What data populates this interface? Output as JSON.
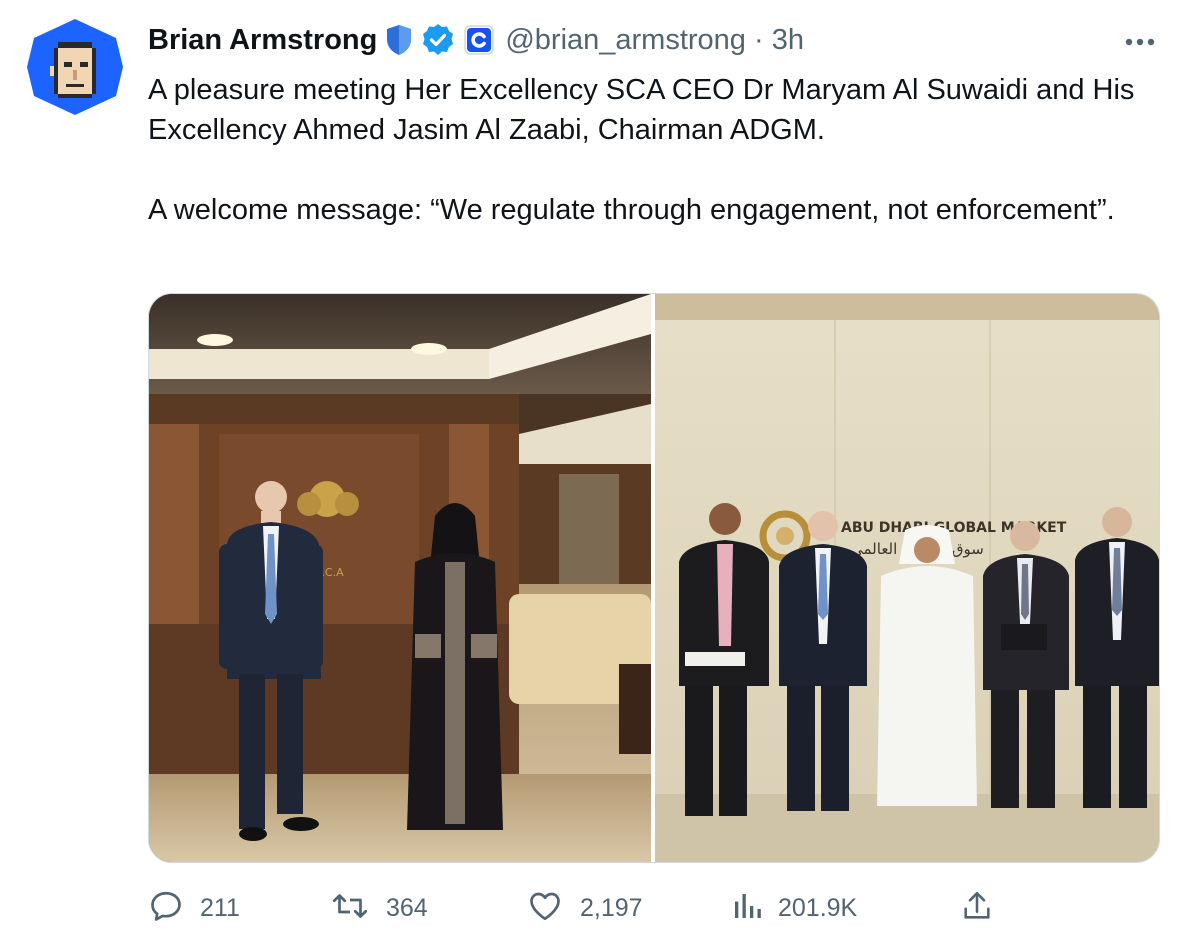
{
  "tweet": {
    "author_name": "Brian Armstrong",
    "handle": "@brian_armstrong",
    "separator": "·",
    "time": "3h",
    "paragraphs": [
      "A pleasure meeting Her Excellency SCA CEO Dr Maryam Al Suwaidi and His Excellency Ahmed Jasim Al Zaabi, Chairman ADGM.",
      "A welcome message: “We regulate through engagement, not enforcement”."
    ],
    "badges": [
      "shield-badge-icon",
      "verified-badge-icon",
      "coinbase-affiliate-icon"
    ]
  },
  "photos": {
    "left": {
      "signage_text": "S.C.A"
    },
    "right": {
      "signage_text": "ABU DHABI GLOBAL MARKET",
      "signage_arabic": "سوق أبوظبي العالمي"
    }
  },
  "metrics": {
    "replies": "211",
    "retweets": "364",
    "likes": "2,197",
    "views": "201.9K"
  },
  "icons": {
    "reply": "reply-icon",
    "retweet": "retweet-icon",
    "like": "heart-icon",
    "views": "views-icon",
    "share": "share-icon",
    "more": "more-icon"
  },
  "colors": {
    "text": "#0f1419",
    "secondary": "#536471",
    "verified": "#1d9bf0",
    "avatar_bg": "#1d63ff",
    "border": "#cfd9de"
  }
}
